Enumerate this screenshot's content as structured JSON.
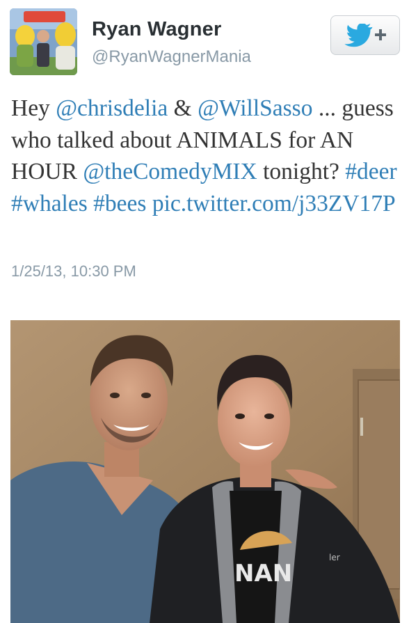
{
  "user": {
    "display_name": "Ryan Wagner",
    "handle": "@RyanWagnerMania"
  },
  "follow_button": {
    "icon": "twitter-bird-plus-icon",
    "label": "+"
  },
  "tweet": {
    "segments": [
      {
        "text": "Hey ",
        "type": "text"
      },
      {
        "text": "@chrisdelia",
        "type": "mention"
      },
      {
        "text": " & ",
        "type": "text"
      },
      {
        "text": "@WillSasso",
        "type": "mention"
      },
      {
        "text": " ... guess who talked about ANIMALS for AN HOUR ",
        "type": "text"
      },
      {
        "text": "@theComedyMIX",
        "type": "mention"
      },
      {
        "text": " tonight? ",
        "type": "text"
      },
      {
        "text": "#deer",
        "type": "hashtag"
      },
      {
        "text": " ",
        "type": "text"
      },
      {
        "text": "#whales",
        "type": "hashtag"
      },
      {
        "text": " ",
        "type": "text"
      },
      {
        "text": "#bees",
        "type": "hashtag"
      },
      {
        "text": " ",
        "type": "text"
      },
      {
        "text": "pic.twitter.com/j33ZV17P",
        "type": "url"
      }
    ],
    "timestamp": "1/25/13, 10:30 PM"
  },
  "photo": {
    "shirt_text": "NAN",
    "jacket_text": "ler"
  },
  "colors": {
    "link": "#2f7eb6",
    "name": "#292f33",
    "meta": "#8899a6",
    "twitter_blue": "#2aa9e0"
  }
}
